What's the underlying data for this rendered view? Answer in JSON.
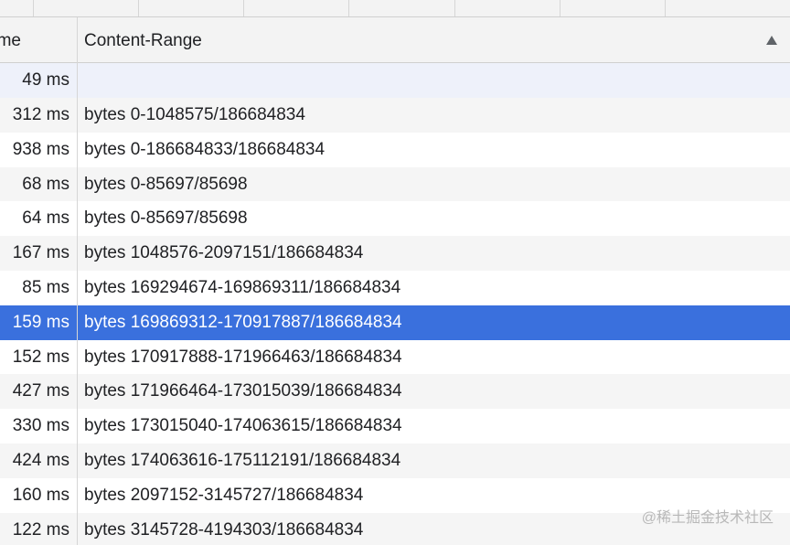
{
  "header": {
    "time_col": "Time",
    "range_col": "Content-Range"
  },
  "rows": [
    {
      "time": "49 ms",
      "range": ""
    },
    {
      "time": "312 ms",
      "range": "bytes 0-1048575/186684834"
    },
    {
      "time": "938 ms",
      "range": "bytes 0-186684833/186684834"
    },
    {
      "time": "68 ms",
      "range": "bytes 0-85697/85698"
    },
    {
      "time": "64 ms",
      "range": "bytes 0-85697/85698"
    },
    {
      "time": "167 ms",
      "range": "bytes 1048576-2097151/186684834"
    },
    {
      "time": "85 ms",
      "range": "bytes 169294674-169869311/186684834"
    },
    {
      "time": "159 ms",
      "range": "bytes 169869312-170917887/186684834"
    },
    {
      "time": "152 ms",
      "range": "bytes 170917888-171966463/186684834"
    },
    {
      "time": "427 ms",
      "range": "bytes 171966464-173015039/186684834"
    },
    {
      "time": "330 ms",
      "range": "bytes 173015040-174063615/186684834"
    },
    {
      "time": "424 ms",
      "range": "bytes 174063616-175112191/186684834"
    },
    {
      "time": "160 ms",
      "range": "bytes 2097152-3145727/186684834"
    },
    {
      "time": "122 ms",
      "range": "bytes 3145728-4194303/186684834"
    }
  ],
  "selected_row_index": 7,
  "sort_icon": "sort-ascending-icon",
  "watermark": "@稀土掘金技术社区",
  "colors": {
    "selected_bg": "#3a70dd",
    "header_bg": "#f3f3f3",
    "stripe_bg": "#f5f5f5"
  }
}
